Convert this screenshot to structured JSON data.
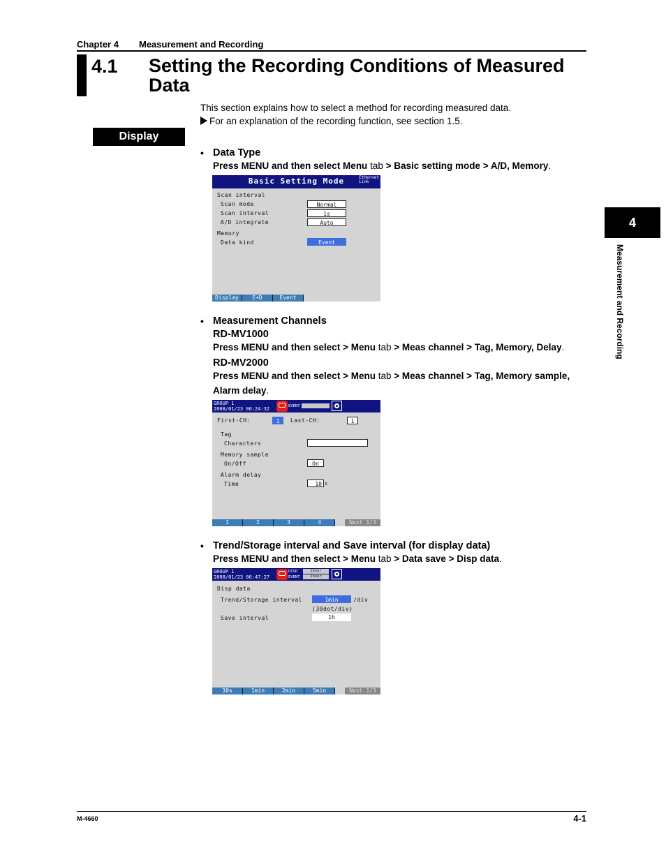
{
  "header": {
    "chapter_label": "Chapter 4",
    "chapter_title": "Measurement and Recording"
  },
  "section": {
    "number": "4.1",
    "title": "Setting the Recording Conditions of Measured Data",
    "intro": "This section explains how to select a method for recording measured data.",
    "reference": "For an explanation of the recording function, see section 1.5."
  },
  "display_label": "Display",
  "side_tab": {
    "number": "4",
    "text": "Measurement and Recording"
  },
  "items": [
    {
      "heading": "Data Type",
      "path_parts": [
        "Press MENU and then select Menu",
        " tab ",
        "> Basic setting mode > A/D, Memory",
        "."
      ]
    },
    {
      "heading": "Measurement Channels",
      "models": [
        {
          "name": "RD-MV1000",
          "path_parts": [
            "Press MENU and then select > Menu",
            " tab ",
            "> Meas channel > Tag, Memory, Delay",
            "."
          ]
        },
        {
          "name": "RD-MV2000",
          "path_parts": [
            "Press MENU and then select > Menu",
            " tab ",
            "> Meas channel > Tag, Memory sample,",
            ""
          ],
          "path_line2": "Alarm delay",
          "path_line2_end": "."
        }
      ]
    },
    {
      "heading": "Trend/Storage interval and Save interval (for display data)",
      "path_parts": [
        "Press MENU and then select > Menu",
        " tab ",
        "> Data save > Disp data",
        "."
      ]
    }
  ],
  "screen1": {
    "title": "Basic Setting Mode",
    "eth_line1": "Ethernet",
    "eth_line2": "Link",
    "scan_group": "Scan interval",
    "scan_mode_label": "Scan mode",
    "scan_mode_value": "Normal",
    "scan_interval_label": "Scan interval",
    "scan_interval_value": "1s",
    "ad_label": "A/D integrate",
    "ad_value": "Auto",
    "memory_group": "Memory",
    "data_kind_label": "Data kind",
    "data_kind_value": "Event",
    "softkeys": [
      "Display",
      "E+D",
      "Event"
    ]
  },
  "screen2": {
    "group": "GROUP 1",
    "datetime": "2008/01/23 06:24:32",
    "mode_label": "EVENT",
    "first_ch_label": "First-CH:",
    "first_ch_value": "1",
    "last_ch_label": "Last-CH:",
    "last_ch_value": "1",
    "tag_group": "Tag",
    "characters_label": "Characters",
    "characters_value": "",
    "memory_group": "Memory sample",
    "onoff_label": "On/Off",
    "onoff_value": "On",
    "alarm_group": "Alarm delay",
    "time_label": "Time",
    "time_value": "10",
    "time_unit": "s",
    "softkeys": [
      "1",
      "2",
      "3",
      "4"
    ],
    "next": "Next 1/3"
  },
  "screen3": {
    "group": "GROUP 1",
    "datetime": "2008/01/23 06:47:27",
    "disp_label": "DISP",
    "event_label": "EVENT",
    "disp_value": "1hour",
    "event_value": "1hour",
    "section": "Disp data",
    "trend_label": "Trend/Storage interval",
    "trend_value": "1min",
    "trend_unit": "/div",
    "trend_note": "(30dot/div)",
    "save_label": "Save interval",
    "save_value": "1h",
    "softkeys": [
      "30s",
      "1min",
      "2min",
      "5min"
    ],
    "next": "Next 1/3"
  },
  "footer": {
    "doc_code": "M-4660",
    "page": "4-1"
  }
}
